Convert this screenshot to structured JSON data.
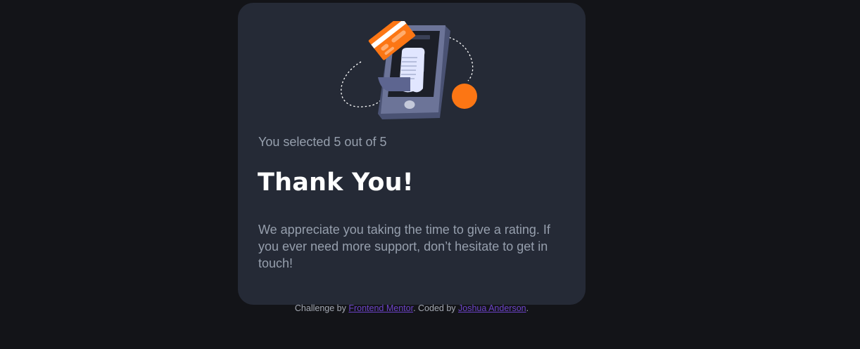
{
  "card": {
    "selected_text": "You selected 5 out of 5",
    "title": "Thank You!",
    "message": "We appreciate you taking the time to give a rating. If you ever need more support, don’t hesitate to get in touch!",
    "illustration_icon": "phone-receipt-card-illustration"
  },
  "attribution": {
    "prefix": "Challenge by ",
    "challenge_link": "Frontend Mentor",
    "middle": ". Coded by ",
    "author_link": "Joshua Anderson",
    "suffix": "."
  },
  "colors": {
    "page_background": "#131418",
    "card_background": "#252a36",
    "accent_orange": "#fc7614",
    "link": "#6c43c8",
    "muted_text": "#969fad"
  }
}
